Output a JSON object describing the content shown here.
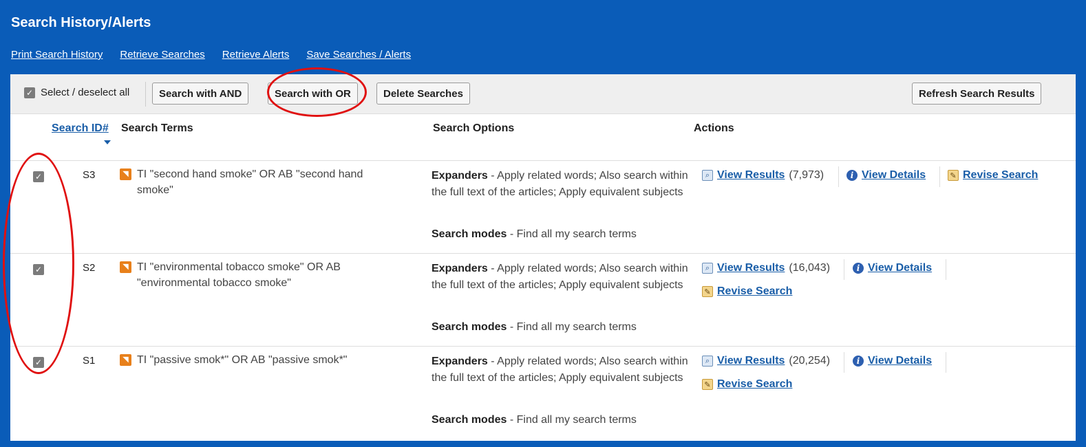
{
  "page": {
    "title": "Search History/Alerts"
  },
  "links": [
    "Print Search History",
    "Retrieve Searches",
    "Retrieve Alerts",
    "Save Searches / Alerts"
  ],
  "toolbar": {
    "select_all": "Select / deselect all",
    "search_and": "Search with AND",
    "search_or": "Search with OR",
    "delete": "Delete Searches",
    "refresh": "Refresh Search Results"
  },
  "table": {
    "headers": {
      "id": "Search ID#",
      "terms": "Search Terms",
      "options": "Search Options",
      "actions": "Actions"
    },
    "rows": [
      {
        "id": "S3",
        "checked": true,
        "terms": "TI \"second hand smoke\" OR AB \"second hand smoke\"",
        "expanders_label": "Expanders",
        "expanders_text": " - Apply related words; Also search within the full text of the articles; Apply equivalent subjects",
        "modes_label": "Search modes",
        "modes_text": " - Find all my search terms",
        "view_results": "View Results",
        "count": "(7,973)",
        "view_details": "View Details",
        "revise": "Revise Search"
      },
      {
        "id": "S2",
        "checked": true,
        "terms": "TI \"environmental tobacco smoke\" OR AB \"environmental tobacco smoke\"",
        "expanders_label": "Expanders",
        "expanders_text": " - Apply related words; Also search within the full text of the articles; Apply equivalent subjects",
        "modes_label": "Search modes",
        "modes_text": " - Find all my search terms",
        "view_results": "View Results",
        "count": "(16,043)",
        "view_details": "View Details",
        "revise": "Revise Search"
      },
      {
        "id": "S1",
        "checked": true,
        "terms": "TI \"passive smok*\" OR AB \"passive smok*\"",
        "expanders_label": "Expanders",
        "expanders_text": " - Apply related words; Also search within the full text of the articles; Apply equivalent subjects",
        "modes_label": "Search modes",
        "modes_text": " - Find all my search terms",
        "view_results": "View Results",
        "count": "(20,254)",
        "view_details": "View Details",
        "revise": "Revise Search"
      }
    ]
  },
  "colors": {
    "background": "#0a5cb8",
    "link": "#1a5ea8",
    "annotation": "#e01010",
    "rss": "#e8801b"
  },
  "icons": {
    "checkbox": "checkmark-icon",
    "rss": "rss-icon",
    "view_results": "magnifier-icon",
    "view_details": "info-icon",
    "revise": "pencil-icon"
  }
}
